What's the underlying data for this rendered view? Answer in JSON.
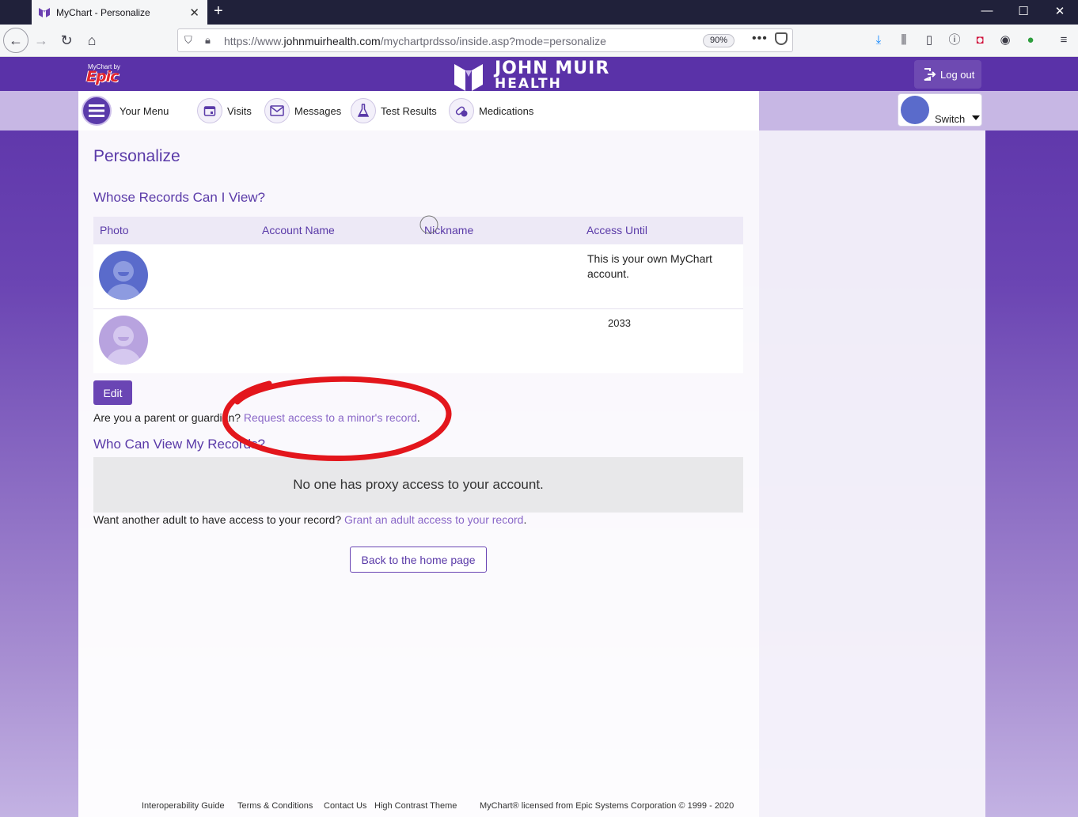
{
  "browser": {
    "tab_title": "MyChart - Personalize",
    "url_prefix": "https://www.",
    "url_host": "johnmuirhealth.com",
    "url_path": "/mychartprdsso/inside.asp?mode=personalize",
    "zoom": "90%",
    "more_label": "•••"
  },
  "header": {
    "epic_small": "MyChart by",
    "epic_big": "Epic",
    "brand_line1": "JOHN MUIR",
    "brand_line2": "HEALTH",
    "logout_label": "Log out"
  },
  "menu": {
    "your_menu": "Your Menu",
    "visits": "Visits",
    "messages": "Messages",
    "test_results": "Test Results",
    "medications": "Medications",
    "switch_label": "Switch"
  },
  "content": {
    "page_title": "Personalize",
    "section1_title": "Whose Records Can I View?",
    "columns": [
      "Photo",
      "Account Name",
      "Nickname",
      "Access Until"
    ],
    "rows": [
      {
        "access_until": "This is your own MyChart account."
      },
      {
        "access_until": "2033"
      }
    ],
    "edit_label": "Edit",
    "guardian_text": "Are you a parent or guardian?",
    "guardian_link": "Request access to a minor's record",
    "period": ".",
    "section2_title": "Who Can View My Records?",
    "no_proxy": "No one has proxy access to your account.",
    "adult_text": "Want another adult to have access to your record?",
    "adult_link": "Grant an adult access to your record",
    "back_label": "Back to the home page"
  },
  "footer": {
    "links": [
      "Interoperability Guide",
      "Terms & Conditions",
      "Contact Us",
      "High Contrast Theme"
    ],
    "license": "MyChart® licensed from Epic Systems Corporation © 1999 - 2020"
  },
  "colors": {
    "brand_purple": "#5a32a8",
    "annotation_red": "#e3161c"
  }
}
